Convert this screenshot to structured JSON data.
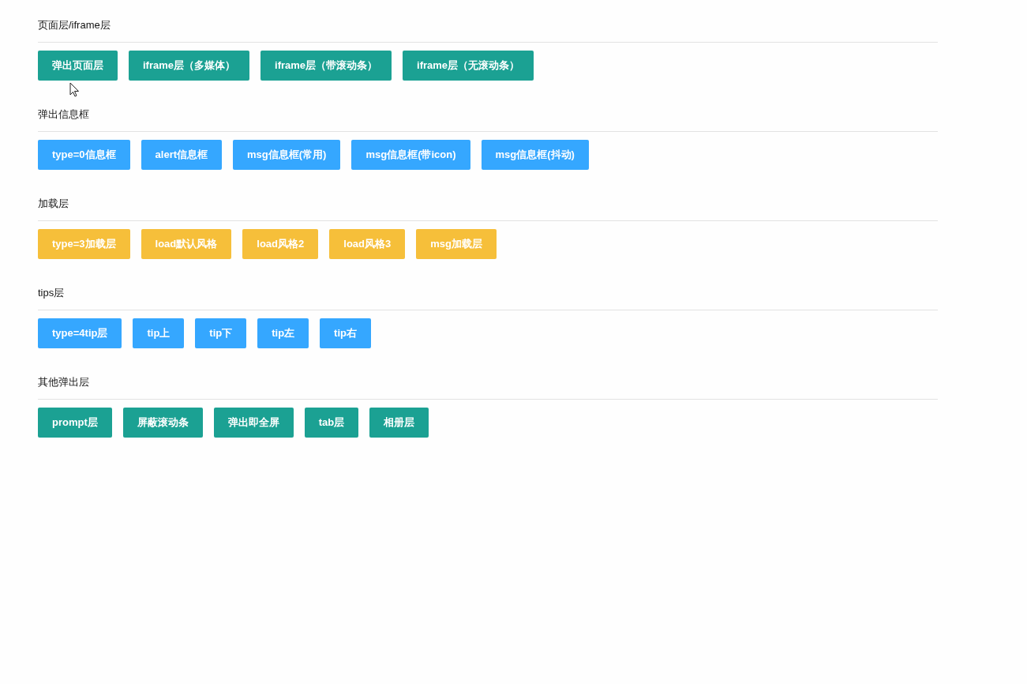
{
  "sections": [
    {
      "title": "页面层/iframe层",
      "color": "#1ba193",
      "buttons": [
        "弹出页面层",
        "iframe层（多媒体）",
        "iframe层（带滚动条）",
        "iframe层（无滚动条）"
      ]
    },
    {
      "title": "弹出信息框",
      "color": "#35a7ff",
      "buttons": [
        "type=0信息框",
        "alert信息框",
        "msg信息框(常用)",
        "msg信息框(带icon)",
        "msg信息框(抖动)"
      ]
    },
    {
      "title": "加载层",
      "color": "#f6bf3a",
      "buttons": [
        "type=3加载层",
        "load默认风格",
        "load风格2",
        "load风格3",
        "msg加载层"
      ]
    },
    {
      "title": "tips层",
      "color": "#35a7ff",
      "buttons": [
        "type=4tip层",
        "tip上",
        "tip下",
        "tip左",
        "tip右"
      ]
    },
    {
      "title": "其他弹出层",
      "color": "#1ba193",
      "buttons": [
        "prompt层",
        "屏蔽滚动条",
        "弹出即全屏",
        "tab层",
        "相册层"
      ]
    }
  ]
}
